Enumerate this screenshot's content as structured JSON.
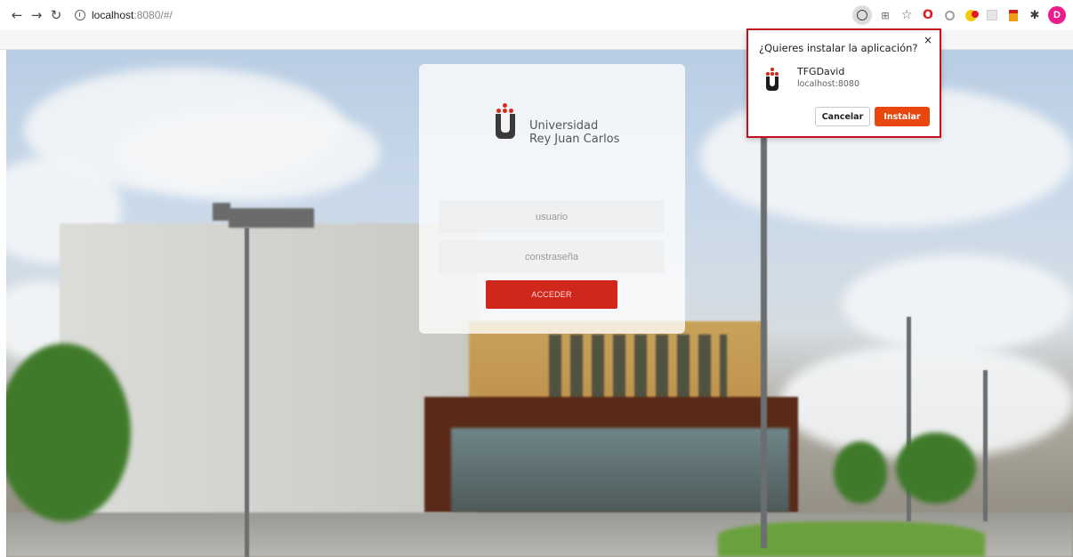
{
  "browser": {
    "url_host": "localhost",
    "url_path": ":8080/#/",
    "profile_initial": "D",
    "icons": {
      "back": "arrow-left-icon",
      "forward": "arrow-right-icon",
      "reload": "reload-icon",
      "site_info": "info-icon",
      "install": "install-app-icon",
      "translate": "translate-icon",
      "bookmark": "star-icon",
      "extensions": "puzzle-icon"
    }
  },
  "login": {
    "logo_line1": "Universidad",
    "logo_line2": "Rey Juan Carlos",
    "username_placeholder": "usuario",
    "password_placeholder": "constraseña",
    "submit_label": "ACCEDER",
    "accent_color": "#d0271c"
  },
  "install_popup": {
    "title": "¿Quieres instalar la aplicación?",
    "close_label": "×",
    "app_name": "TFGDavid",
    "app_origin": "localhost:8080",
    "cancel_label": "Cancelar",
    "install_label": "Instalar",
    "install_color": "#e8470f",
    "highlight_color": "#c1121f"
  }
}
